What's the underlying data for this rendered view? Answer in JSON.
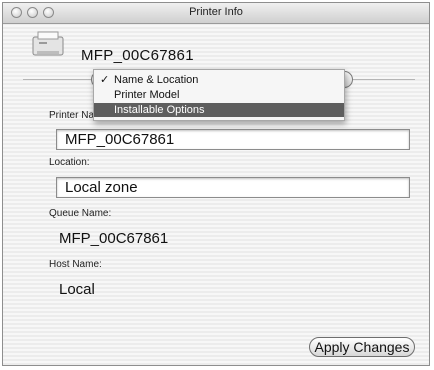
{
  "window": {
    "title": "Printer Info"
  },
  "printer": {
    "name": "MFP_00C67861",
    "icon": "printer-icon"
  },
  "menu": {
    "items": [
      {
        "label": "Name & Location",
        "checked": true
      },
      {
        "label": "Printer Model",
        "checked": false
      },
      {
        "label": "Installable Options",
        "checked": false,
        "highlighted": true
      }
    ],
    "check_mark": "✓"
  },
  "fields": {
    "printer_name_label": "Printer Na",
    "printer_name_value": "MFP_00C67861",
    "location_label": "Location:",
    "location_value": "Local zone",
    "queue_label": "Queue Name:",
    "queue_value": "MFP_00C67861",
    "host_label": "Host Name:",
    "host_value": "Local"
  },
  "buttons": {
    "apply": "Apply Changes"
  },
  "colors": {
    "menu_highlight": "#5e5e5e",
    "window_bg": "#ececec"
  }
}
